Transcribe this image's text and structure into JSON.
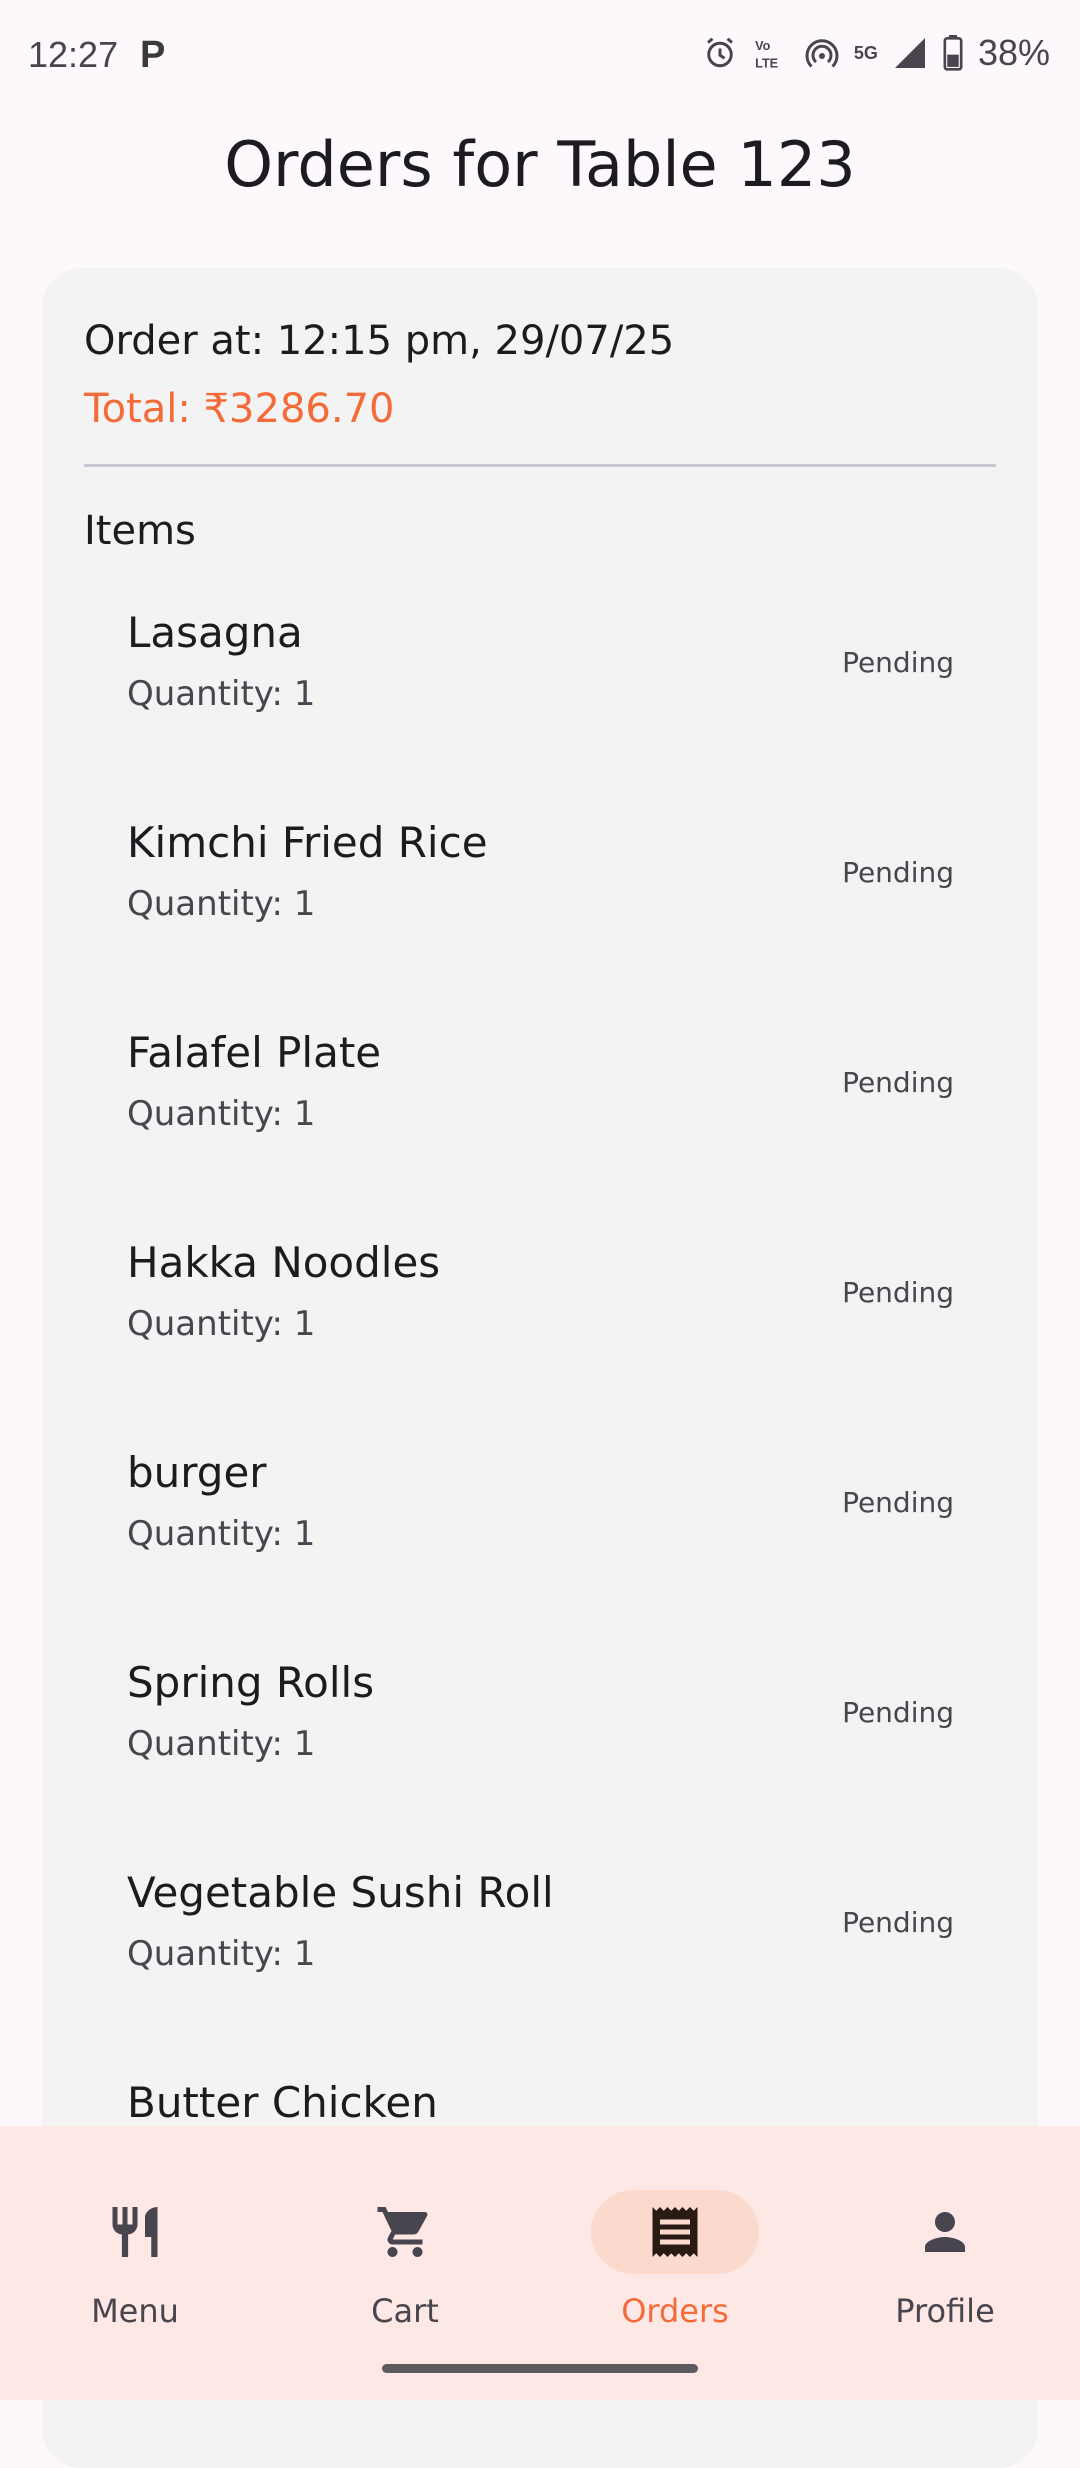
{
  "status_bar": {
    "time": "12:27",
    "notification_icon": "P",
    "network": "5G",
    "battery": "38%",
    "icons": [
      "alarm-icon",
      "volte-icon",
      "hotspot-icon",
      "signal-icon",
      "battery-icon"
    ]
  },
  "page": {
    "title": "Orders for Table 123"
  },
  "order": {
    "ordered_at": "Order at: 12:15 pm, 29/07/25",
    "total": "Total: ₹3286.70",
    "items_heading": "Items",
    "items": [
      {
        "name": "Lasagna",
        "quantity": "Quantity: 1",
        "status": "Pending"
      },
      {
        "name": "Kimchi Fried Rice",
        "quantity": "Quantity: 1",
        "status": "Pending"
      },
      {
        "name": "Falafel Plate",
        "quantity": "Quantity: 1",
        "status": "Pending"
      },
      {
        "name": "Hakka Noodles",
        "quantity": "Quantity: 1",
        "status": "Pending"
      },
      {
        "name": "burger",
        "quantity": "Quantity: 1",
        "status": "Pending"
      },
      {
        "name": "Spring Rolls",
        "quantity": "Quantity: 1",
        "status": "Pending"
      },
      {
        "name": "Vegetable Sushi Roll",
        "quantity": "Quantity: 1",
        "status": "Pending"
      },
      {
        "name": "Butter Chicken",
        "quantity": "",
        "status": ""
      }
    ]
  },
  "bottom_nav": {
    "items": [
      {
        "label": "Menu",
        "icon": "restaurant-icon",
        "active": false
      },
      {
        "label": "Cart",
        "icon": "cart-icon",
        "active": false
      },
      {
        "label": "Orders",
        "icon": "receipt-icon",
        "active": true
      },
      {
        "label": "Profile",
        "icon": "person-icon",
        "active": false
      }
    ]
  },
  "colors": {
    "accent": "#f26b38",
    "nav_background": "#fde8e6",
    "active_pill": "#fcd9cd",
    "card_background": "#f3f3f3",
    "page_background": "#fdf8fb"
  }
}
